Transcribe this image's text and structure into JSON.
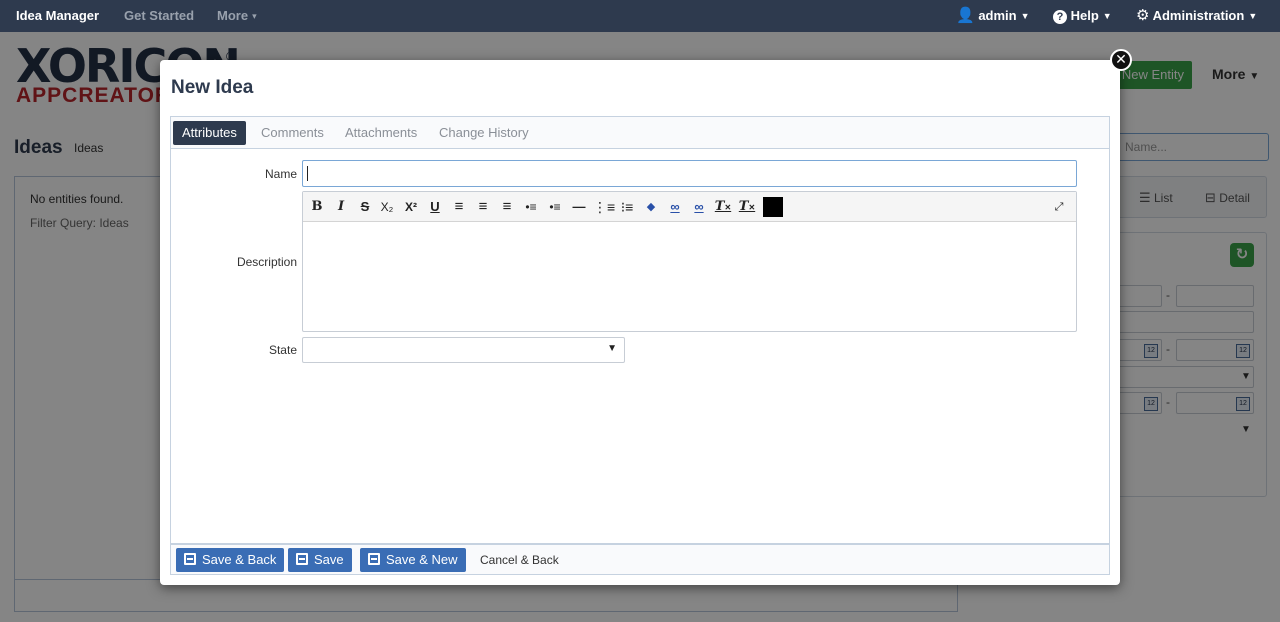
{
  "navbar": {
    "brand": "Idea Manager",
    "get_started": "Get Started",
    "more": "More",
    "user": "admin",
    "help": "Help",
    "administration": "Administration"
  },
  "logo": {
    "top": "XORICON",
    "reg": "®",
    "bottom": "APPCREATOR"
  },
  "background": {
    "title": "Ideas",
    "title_sub": "Ideas",
    "no_entities": "No entities found.",
    "filter_query": "Filter Query: Ideas",
    "new_entity": "New Entity",
    "more": "More",
    "search_placeholder": "Name...",
    "view_list": "List",
    "view_detail": "Detail"
  },
  "modal": {
    "title": "New Idea",
    "tabs": [
      {
        "label": "Attributes",
        "active": true
      },
      {
        "label": "Comments",
        "active": false
      },
      {
        "label": "Attachments",
        "active": false
      },
      {
        "label": "Change History",
        "active": false
      }
    ],
    "fields": {
      "name_label": "Name",
      "name_value": "",
      "description_label": "Description",
      "state_label": "State",
      "state_value": ""
    },
    "toolbar_buttons": [
      {
        "icon": "bold-icon",
        "glyph": "B"
      },
      {
        "icon": "italic-icon",
        "glyph": "I"
      },
      {
        "icon": "strikethrough-icon",
        "glyph": "S"
      },
      {
        "icon": "subscript-icon",
        "glyph": "X₂"
      },
      {
        "icon": "superscript-icon",
        "glyph": "X²"
      },
      {
        "icon": "underline-icon",
        "glyph": "U"
      },
      {
        "icon": "align-left-icon",
        "glyph": "≡"
      },
      {
        "icon": "align-center-icon",
        "glyph": "≡"
      },
      {
        "icon": "align-right-icon",
        "glyph": "≡"
      },
      {
        "icon": "indent-icon",
        "glyph": "⇥"
      },
      {
        "icon": "outdent-icon",
        "glyph": "⇤"
      },
      {
        "icon": "horizontal-rule-icon",
        "glyph": "—"
      },
      {
        "icon": "ordered-list-icon",
        "glyph": "☰"
      },
      {
        "icon": "unordered-list-icon",
        "glyph": "☷"
      },
      {
        "icon": "eraser-icon",
        "glyph": "◆"
      },
      {
        "icon": "link-icon",
        "glyph": "∞"
      },
      {
        "icon": "unlink-icon",
        "glyph": "∞"
      },
      {
        "icon": "remove-format-icon",
        "glyph": "T"
      },
      {
        "icon": "clear-formatting-icon",
        "glyph": "T"
      }
    ],
    "text_color": "#000000",
    "buttons": {
      "save_back": "Save & Back",
      "save": "Save",
      "save_new": "Save & New",
      "cancel_back": "Cancel & Back"
    }
  },
  "colors": {
    "navbar": "#2e3a4e",
    "primary_button": "#3a6db5",
    "success": "#3aa44a",
    "logo_red": "#b9262b"
  }
}
